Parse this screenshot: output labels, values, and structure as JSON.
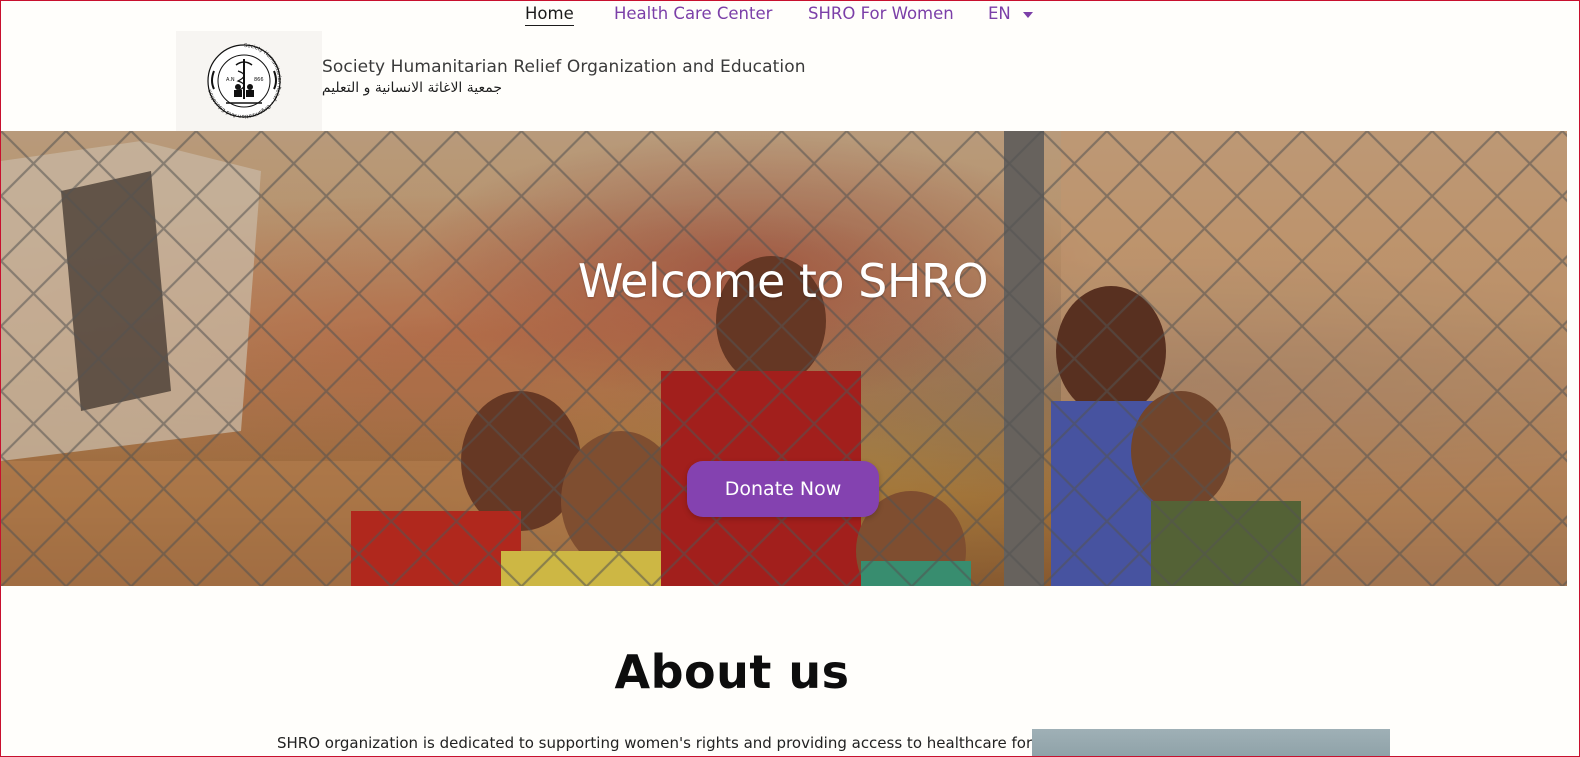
{
  "nav": {
    "items": [
      {
        "label": "Home",
        "active": true
      },
      {
        "label": "Health Care Center",
        "active": false
      },
      {
        "label": "SHRO For Women",
        "active": false
      }
    ],
    "language": "EN"
  },
  "header": {
    "org_name_en": "Society Humanitarian Relief Organization and Education",
    "org_name_ar": "جمعية الاغاثة الانسانية و التعليم",
    "logo": {
      "ring_text": "Society Humanitarian Relief • Organization And Education",
      "year_left": "A.N",
      "year_right": "866"
    }
  },
  "hero": {
    "title": "Welcome to SHRO",
    "cta_label": "Donate Now"
  },
  "about": {
    "title": "About us",
    "text": "SHRO organization is dedicated to supporting women's rights and providing access to healthcare for"
  },
  "colors": {
    "accent": "#8442b0",
    "nav_link": "#7b3fa8",
    "frame": "#c8102e"
  }
}
